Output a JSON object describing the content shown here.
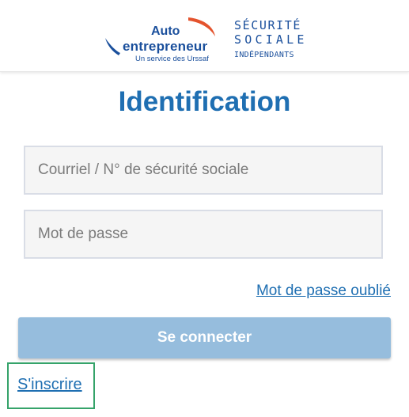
{
  "header": {
    "ae_logo": {
      "line1": "Auto",
      "line2": "entrepreneur",
      "tagline": "Un service des Urssaf"
    },
    "ssi_logo": {
      "line1": "SÉCURITÉ",
      "line2": "SOCIALE",
      "line3": "INDÉPENDANTS"
    }
  },
  "page_title": "Identification",
  "form": {
    "email_placeholder": "Courriel / N° de sécurité sociale",
    "email_value": "",
    "password_placeholder": "Mot de passe",
    "password_value": "",
    "forgot_password_link": "Mot de passe oublié",
    "submit_label": "Se connecter",
    "register_link": "S'inscrire"
  },
  "colors": {
    "brand_blue": "#1f6fb2",
    "logo_blue": "#1a4f9c",
    "logo_red": "#e4532d",
    "button_disabled": "#96bddd",
    "focus_outline": "#35a36a"
  }
}
